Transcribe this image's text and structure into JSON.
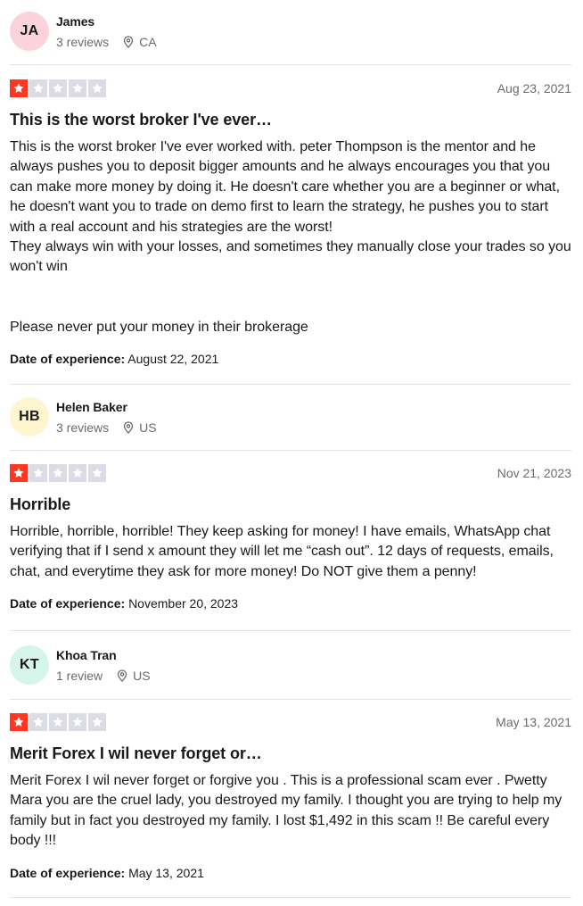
{
  "reviews": [
    {
      "avatar_initials": "JA",
      "avatar_bg": "#fbd3dc",
      "name": "James",
      "review_count": "3 reviews",
      "location": "CA",
      "rating": 1,
      "date": "Aug 23, 2021",
      "title": "This is the worst broker I've ever…",
      "body": "This is the worst broker I've ever worked with. peter Thompson is the mentor and he always pushes you to deposit bigger amounts and he always encourages you that you can make more money by doing it. He doesn't care whether you are a beginner or what, he doesn't want you to trade on demo first to learn the strategy, he pushes you to start with a real account and his strategies are the worst!\nThey always win with your losses, and sometimes they manually close your trades so you won't win\n\n\nPlease never put your money in their brokerage",
      "experience_label": "Date of experience:",
      "experience_date": "August 22, 2021"
    },
    {
      "avatar_initials": "HB",
      "avatar_bg": "#fff6d0",
      "name": "Helen Baker",
      "review_count": "3 reviews",
      "location": "US",
      "rating": 1,
      "date": "Nov 21, 2023",
      "title": "Horrible",
      "body": "Horrible, horrible, horrible! They keep asking for money! I have emails, WhatsApp chat verifying that if I send x amount they will let me “cash out”. 12 days of requests, emails, chat, and everytime they ask for more money! Do NOT give them a penny!",
      "experience_label": "Date of experience:",
      "experience_date": "November 20, 2023"
    },
    {
      "avatar_initials": "KT",
      "avatar_bg": "#d6f5ea",
      "name": "Khoa Tran",
      "review_count": "1 review",
      "location": "US",
      "rating": 1,
      "date": "May 13, 2021",
      "title": "Merit Forex I wil never forget or…",
      "body": "Merit Forex I wil never forget or forgive you . This is a professional scam ever . Pwetty Mara you are the cruel lady, you destroyed my family. I thought you are trying to help my family but in fact you destroyed my family. I lost $1,492 in this scam !! Be careful every body !!!",
      "experience_label": "Date of experience:",
      "experience_date": "May 13, 2021"
    }
  ],
  "colors": {
    "star_on": "#ff3722",
    "star_off": "#dcdce6",
    "muted_text": "#6b6b6b",
    "divider": "#e5e5dd"
  },
  "icons": [
    "location-pin-icon",
    "star-icon"
  ]
}
